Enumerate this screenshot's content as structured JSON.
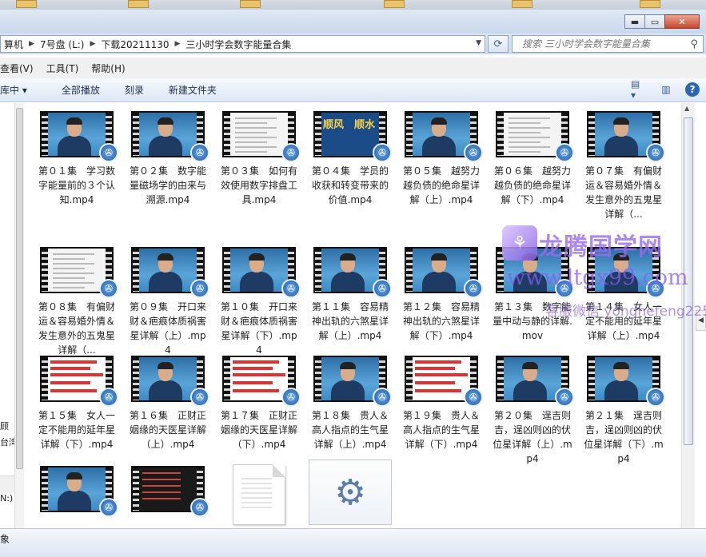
{
  "window": {
    "minimize_glyph": "▬",
    "maximize_glyph": "▭",
    "close_glyph": "✕"
  },
  "address": {
    "crumbs": [
      "算机",
      "7号盘 (L:)",
      "下载20211130",
      "三小时学会数字能量合集"
    ]
  },
  "search": {
    "placeholder": "搜索 三小时学会数字能量合集"
  },
  "menu": [
    "查看(V)",
    "工具(T)",
    "帮助(H)"
  ],
  "toolbar": [
    "库中 ▾",
    "全部播放",
    "刻录",
    "新建文件夹"
  ],
  "nav": {
    "labels": [
      "顾",
      "台湾",
      "N:)"
    ]
  },
  "files": [
    {
      "label": "第０１集　学习数字能量前的３个认知.mp4",
      "thumb": "person"
    },
    {
      "label": "第０２集　数字能量磁场学的由来与溯源.mp4",
      "thumb": "person"
    },
    {
      "label": "第０３集　如何有效使用数字排盘工具.mp4",
      "thumb": "doc"
    },
    {
      "label": "第０４集　学员的收获和转变带来的价值.mp4",
      "thumb": "banner",
      "banner_text": "顺风　顺水"
    },
    {
      "label": "第０５集　越努力越负债的绝命星详解（上）.mp4",
      "thumb": "person"
    },
    {
      "label": "第０６集　越努力越负债的绝命星详解（下）.mp4",
      "thumb": "doc"
    },
    {
      "label": "第０７集　有偏财运＆容易婚外情＆发生意外的五鬼星详解（...",
      "thumb": "person"
    },
    {
      "label": "第０８集　有偏财运＆容易婚外情＆发生意外的五鬼星详解（...",
      "thumb": "doc"
    },
    {
      "label": "第０９集　开口来财＆疤痕体质祸害星详解（上）.mp4",
      "thumb": "person"
    },
    {
      "label": "第１０集　开口来财＆疤痕体质祸害星详解（下）.mp4",
      "thumb": "person"
    },
    {
      "label": "第１１集　容易精神出轨的六煞星详解（上）.mp4",
      "thumb": "person"
    },
    {
      "label": "第１２集　容易精神出轨的六煞星详解（下）.mp4",
      "thumb": "person"
    },
    {
      "label": "第１３集　数字能量中动与静的详解.mov",
      "thumb": "person"
    },
    {
      "label": "第１４集　女人一定不能用的延年星详解（上）.mp4",
      "thumb": "person"
    },
    {
      "label": "第１５集　女人一定不能用的延年星详解（下）.mp4",
      "thumb": "red"
    },
    {
      "label": "第１６集　正财正姻缘的天医星详解（上）.mp4",
      "thumb": "person"
    },
    {
      "label": "第１７集　正财正姻缘的天医星详解（下）.mp4",
      "thumb": "red"
    },
    {
      "label": "第１８集　贵人＆高人指点的生气星详解（上）.mp4",
      "thumb": "person"
    },
    {
      "label": "第１９集　贵人＆高人指点的生气星详解（下）.mp4",
      "thumb": "red"
    },
    {
      "label": "第２０集　逞吉则吉，逞凶则凶的伏位星详解（上）.mp4",
      "thumb": "person"
    },
    {
      "label": "第２１集　逞吉则吉，逞凶则凶的伏位星详解（下）.mp4",
      "thumb": "person"
    },
    {
      "label": "",
      "thumb": "person"
    },
    {
      "label": "",
      "thumb": "dark"
    },
    {
      "label": "",
      "thumb": "blank"
    },
    {
      "label": "",
      "thumb": "gear"
    }
  ],
  "watermark": {
    "name": "龙腾国学网",
    "url": "www.ltgx99.com",
    "wechat": "客服微信 yonghefeng225"
  },
  "status": {
    "text": "象"
  }
}
